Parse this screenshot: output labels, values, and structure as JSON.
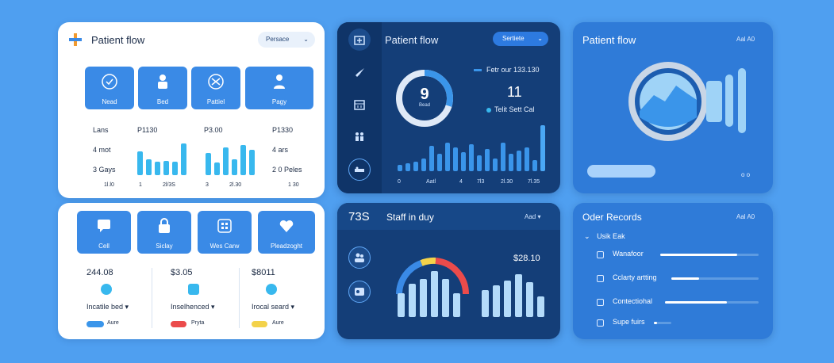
{
  "card1": {
    "title": "Patient flow",
    "dropdown": "Persace",
    "tiles": [
      "Nead",
      "Bed",
      "Pattiel",
      "Pagy"
    ],
    "stats_left": [
      "Lans",
      "4 mot",
      "3 Gays",
      "1l.l0"
    ],
    "col_headers": [
      "P1130",
      "P3.00",
      "P1330"
    ],
    "col_right_rows": [
      "4 ars",
      "2 0 Peles",
      "1 30"
    ],
    "axis": [
      "1",
      "2l/3S",
      "3",
      "2l.30"
    ]
  },
  "card2": {
    "title": "Patient flow",
    "dropdown": "Sertiete",
    "donut_value": "9",
    "donut_sub": "Bead",
    "legend1": "Fetr our 133.130",
    "big_value": "11",
    "legend2": "Telit Sett Cal",
    "axis": [
      "0",
      "Aatl",
      "4",
      "7l3",
      "2l.30",
      "7l.35"
    ]
  },
  "card3": {
    "title": "Patient flow",
    "menu": "Aal A0",
    "footer": "o o"
  },
  "card4": {
    "tiles": [
      "Cell",
      "Siclay",
      "Wes Carw",
      "Pleadzoght"
    ],
    "values": [
      "244.08",
      "$3.05",
      "$8011"
    ],
    "labels": [
      "Incatile bed ▾",
      "Inselhenced ▾",
      "Irocal seard ▾"
    ],
    "pills": [
      "Aure",
      "Pryta",
      "Aure"
    ]
  },
  "card5": {
    "count": "73S",
    "title": "Staff in duy",
    "menu": "Aad ▾",
    "value": "$28.10"
  },
  "card6": {
    "title": "Oder Records",
    "menu": "Aal A0",
    "group": "Usik Eak",
    "rows": [
      "Wanafoor",
      "Cclarty artting",
      "Contectiohal",
      "Supe fuirs"
    ],
    "fill_fractions": [
      0.78,
      0.32,
      0.66,
      0.2
    ]
  },
  "colors": {
    "background": "#4f9ff0",
    "dark_card": "#143e78",
    "accent": "#3a8ae6",
    "cyan": "#38b8ee"
  }
}
